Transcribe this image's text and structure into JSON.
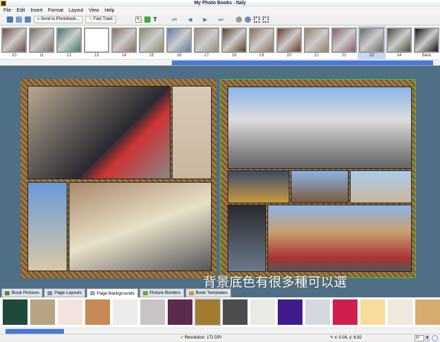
{
  "window": {
    "title": "My Photo Books  -  Italy"
  },
  "menu": [
    "File",
    "Edit",
    "Insert",
    "Format",
    "Layout",
    "View",
    "Help"
  ],
  "toolbar": {
    "send_label": "Send to Photobook...",
    "fast_track_label": "Fast Track"
  },
  "thumbnails": [
    {
      "label": "10",
      "color": "#6a4a3a"
    },
    {
      "label": "11",
      "color": "#7a6a5a"
    },
    {
      "label": "12",
      "color": "#3d7a6a"
    },
    {
      "label": "13",
      "color": "#ffffff"
    },
    {
      "label": "14",
      "color": "#8a6a5a"
    },
    {
      "label": "15",
      "color": "#8a8a6a"
    },
    {
      "label": "16",
      "color": "#5a7aa8"
    },
    {
      "label": "17",
      "color": "#9a8a7a"
    },
    {
      "label": "18",
      "color": "#5a4020"
    },
    {
      "label": "19",
      "color": "#8a7050"
    },
    {
      "label": "20",
      "color": "#6a3a1a"
    },
    {
      "label": "21",
      "color": "#9a8060"
    },
    {
      "label": "22",
      "color": "#8a5a6a"
    },
    {
      "label": "23",
      "color": "#6a6a6a",
      "selected": true
    },
    {
      "label": "24",
      "color": "#4a4a3a"
    },
    {
      "label": "Back",
      "color": "#111111"
    }
  ],
  "caption": "背景底色有很多種可以選",
  "tabs": [
    {
      "label": "Book Pictures"
    },
    {
      "label": "Page Layouts"
    },
    {
      "label": "Page Backgrounds",
      "active": true
    },
    {
      "label": "Picture Borders"
    },
    {
      "label": "Book Templates"
    }
  ],
  "swatches": [
    "#1e4a3a",
    "#b8a383",
    "#f5e3df",
    "#c58a55",
    "#ececec",
    "#c7c5c4",
    "#5c2a4c",
    "#a47b2c",
    "#4e4c4c",
    "#ebe9e3",
    "#3f1c8c",
    "#d5d8df",
    "#d01f4c",
    "#f8dc9c",
    "#efe8dc",
    "#d6ac6c"
  ],
  "status": {
    "resolution": "Resolution: 172 DPI",
    "coords": "x: 0.04, y: 6.92",
    "unit": "in"
  }
}
